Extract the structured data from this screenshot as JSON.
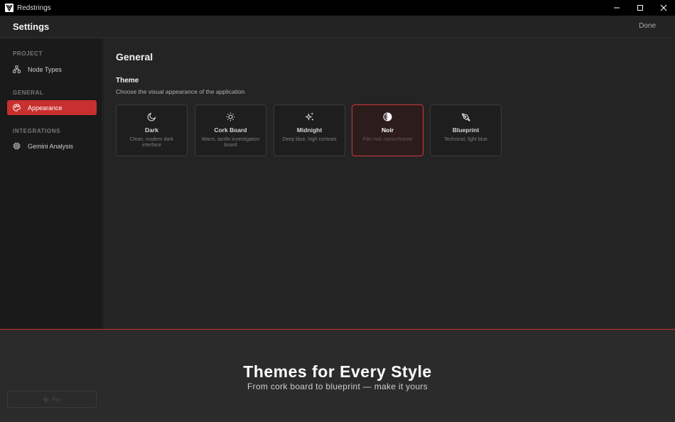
{
  "window": {
    "app_title": "Redstrings"
  },
  "header": {
    "title": "Settings",
    "done_label": "Done"
  },
  "sidebar": {
    "sections": [
      {
        "label": "PROJECT",
        "items": [
          {
            "label": "Node Types",
            "icon": "node-types-icon",
            "active": false
          }
        ]
      },
      {
        "label": "GENERAL",
        "items": [
          {
            "label": "Appearance",
            "icon": "palette-icon",
            "active": true
          }
        ]
      },
      {
        "label": "INTEGRATIONS",
        "items": [
          {
            "label": "Gemini Analysis",
            "icon": "chip-icon",
            "active": false
          }
        ]
      }
    ]
  },
  "main": {
    "title": "General",
    "theme_section": {
      "title": "Theme",
      "description": "Choose the visual appearance of the application",
      "selected": "Noir",
      "options": [
        {
          "name": "Dark",
          "desc": "Clean, modern dark interface",
          "icon": "moon-icon"
        },
        {
          "name": "Cork Board",
          "desc": "Warm, tactile investigation board",
          "icon": "sun-icon"
        },
        {
          "name": "Midnight",
          "desc": "Deep blue, high contrast",
          "icon": "sparkles-icon"
        },
        {
          "name": "Noir",
          "desc": "Film noir monochrome",
          "icon": "contrast-icon"
        },
        {
          "name": "Blueprint",
          "desc": "Technical, light blue",
          "icon": "pen-tool-icon"
        }
      ]
    }
  },
  "banner": {
    "title": "Themes for Every Style",
    "subtitle": "From cork board to blueprint — make it yours",
    "ghost_button_label": "Pro"
  },
  "colors": {
    "accent": "#c8302f",
    "background": "#242424",
    "sidebar": "#1a1a1a",
    "titlebar": "#000000"
  }
}
